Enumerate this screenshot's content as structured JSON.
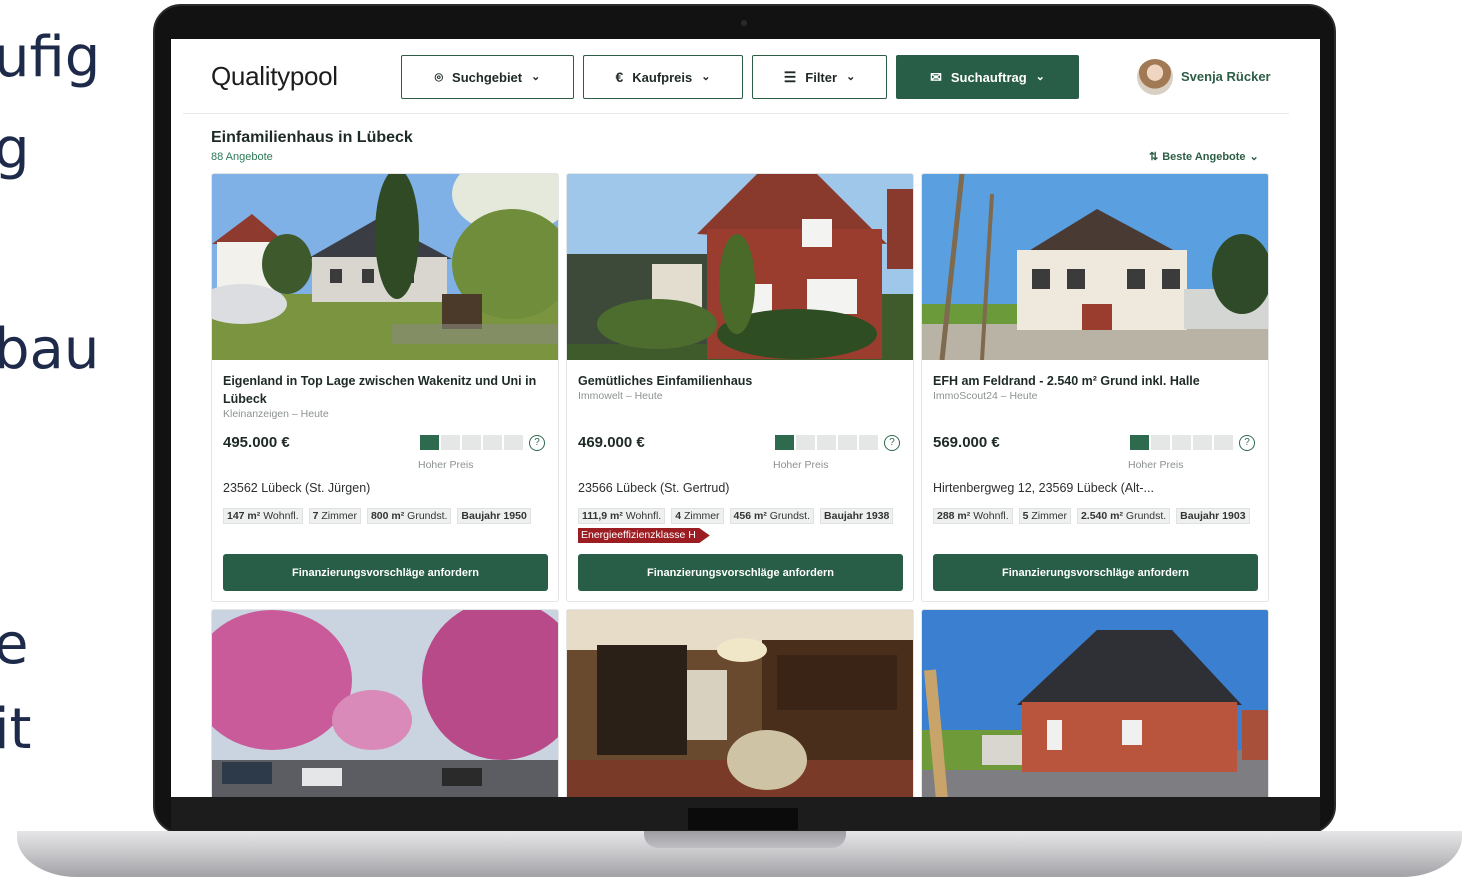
{
  "side_text": [
    "ufig",
    "g",
    "bau",
    "e",
    "it"
  ],
  "app": {
    "logo": "Qualitypool",
    "toolbar": {
      "area": "Suchgebiet",
      "price": "Kaufpreis",
      "filter": "Filter",
      "order": "Suchauftrag"
    },
    "user": {
      "name": "Svenja Rücker"
    }
  },
  "results": {
    "title": "Einfamilienhaus in Lübeck",
    "count": "88 Angebote",
    "sort": "Beste Angebote"
  },
  "listings": [
    {
      "title": "Eigenland in Top Lage zwischen Wakenitz und Uni in Lübeck",
      "source": "Kleinanzeigen – Heute",
      "price": "495.000 €",
      "price_rating": 1,
      "price_rating_max": 5,
      "price_label": "Hoher Preis",
      "address": "23562 Lübeck (St. Jürgen)",
      "tags": [
        {
          "value": "147 m²",
          "unit": " Wohnfl."
        },
        {
          "value": "7",
          "unit": " Zimmer"
        },
        {
          "value": "800 m²",
          "unit": " Grundst."
        },
        {
          "value": "",
          "unit": "Baujahr 1950"
        }
      ],
      "cta": "Finanzierungsvorschläge anfordern"
    },
    {
      "title": "Gemütliches Einfamilienhaus",
      "source": "Immowelt – Heute",
      "price": "469.000 €",
      "price_rating": 1,
      "price_rating_max": 5,
      "price_label": "Hoher Preis",
      "address": "23566 Lübeck (St. Gertrud)",
      "tags": [
        {
          "value": "111,9 m²",
          "unit": " Wohnfl."
        },
        {
          "value": "4",
          "unit": " Zimmer"
        },
        {
          "value": "456 m²",
          "unit": " Grundst."
        },
        {
          "value": "",
          "unit": "Baujahr 1938"
        }
      ],
      "energy": "Energieeffizienzklasse H",
      "cta": "Finanzierungsvorschläge anfordern"
    },
    {
      "title": "EFH am Feldrand - 2.540 m² Grund inkl. Halle",
      "source": "ImmoScout24 – Heute",
      "price": "569.000 €",
      "price_rating": 1,
      "price_rating_max": 5,
      "price_label": "Hoher Preis",
      "address": "Hirtenbergweg 12, 23569 Lübeck (Alt-...",
      "tags": [
        {
          "value": "288 m²",
          "unit": " Wohnfl."
        },
        {
          "value": "5",
          "unit": " Zimmer"
        },
        {
          "value": "2.540 m²",
          "unit": " Grundst."
        },
        {
          "value": "",
          "unit": "Baujahr 1903"
        }
      ],
      "cta": "Finanzierungsvorschläge anfordern"
    }
  ],
  "colors": {
    "brand": "#285d47",
    "energy_badge": "#9b1d22"
  }
}
